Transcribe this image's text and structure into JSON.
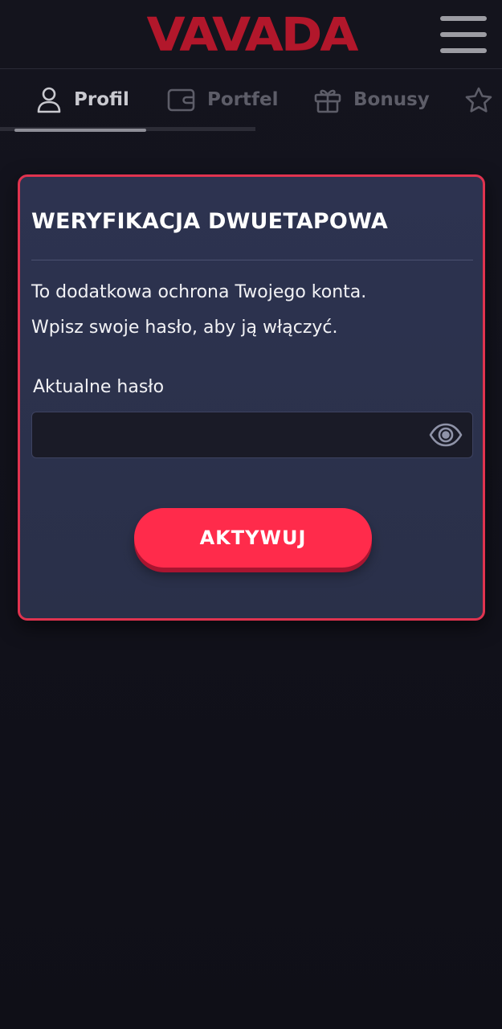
{
  "header": {
    "logo_text": "VAVADA",
    "brand_color": "#b2172b"
  },
  "tabs": [
    {
      "label": "Profil",
      "icon": "user-icon",
      "active": true
    },
    {
      "label": "Portfel",
      "icon": "wallet-icon",
      "active": false
    },
    {
      "label": "Bonusy",
      "icon": "gift-icon",
      "active": false
    },
    {
      "label": "",
      "icon": "star-icon",
      "active": false
    }
  ],
  "card": {
    "title": "WERYFIKACJA DWUETAPOWA",
    "description_line1": "To dodatkowa ochrona Twojego konta.",
    "description_line2": "Wpisz swoje hasło, aby ją włączyć.",
    "password_label": "Aktualne hasło",
    "password_value": "",
    "activate_label": "AKTYWUJ",
    "accent_color": "#ff2b4b",
    "border_color": "#e0334f"
  }
}
